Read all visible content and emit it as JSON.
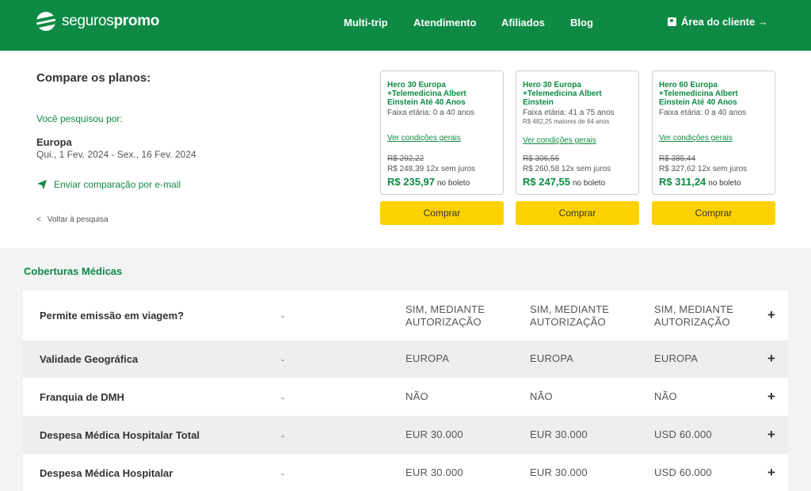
{
  "header": {
    "logo_thin": "seguros",
    "logo_bold": "promo",
    "nav": [
      "Multi-trip",
      "Atendimento",
      "Afiliados",
      "Blog"
    ],
    "client_area": "Área do cliente →"
  },
  "search": {
    "title": "Compare os planos:",
    "searched_label": "Você pesquisou por:",
    "destination": "Europa",
    "dates": "Qui., 1 Fev. 2024 - Sex., 16 Fev. 2024",
    "send_email": "Enviar comparação por e-mail",
    "back": "Voltar à pesquisa",
    "back_chevron": "<"
  },
  "plans": [
    {
      "name": "Hero 30 Europa +Telemedicina Albert Einstein Até 40 Anos",
      "age": "Faixa etária: 0 a 40 anos",
      "age_note": "",
      "conditions": "Ver condições gerais",
      "old_price": "R$ 292,22",
      "installments": "R$ 248,39 12x sem juros",
      "price": "R$ 235,97",
      "price_suffix": "no boleto",
      "buy": "Comprar"
    },
    {
      "name": "Hero 30 Europa +Telemedicina Albert Einstein",
      "age": "Faixa etária: 41 a 75 anos",
      "age_note": "R$ 482,25 maiores de 64 anos",
      "conditions": "Ver condições gerais",
      "old_price": "R$ 306,56",
      "installments": "R$ 260,58 12x sem juros",
      "price": "R$ 247,55",
      "price_suffix": "no boleto",
      "buy": "Comprar"
    },
    {
      "name": "Hero 60 Europa +Telemedicina Albert Einstein Até 40 Anos",
      "age": "Faixa etária: 0 a 40 anos",
      "age_note": "",
      "conditions": "Ver condições gerais",
      "old_price": "R$ 385,44",
      "installments": "R$ 327,62 12x sem juros",
      "price": "R$ 311,24",
      "price_suffix": "no boleto",
      "buy": "Comprar"
    }
  ],
  "coverage": {
    "title": "Coberturas Médicas",
    "rows": [
      {
        "label": "Permite emissão em viagem?",
        "dash": "-",
        "values": [
          "SIM, MEDIANTE AUTORIZAÇÃO",
          "SIM, MEDIANTE AUTORIZAÇÃO",
          "SIM, MEDIANTE AUTORIZAÇÃO"
        ],
        "plus": "+"
      },
      {
        "label": "Validade Geográfica",
        "dash": "-",
        "values": [
          "EUROPA",
          "EUROPA",
          "EUROPA"
        ],
        "plus": "+"
      },
      {
        "label": "Franquia de DMH",
        "dash": "-",
        "values": [
          "NÃO",
          "NÃO",
          "NÃO"
        ],
        "plus": "+"
      },
      {
        "label": "Despesa Médica Hospitalar Total",
        "dash": "-",
        "values": [
          "EUR 30.000",
          "EUR 30.000",
          "USD 60.000"
        ],
        "plus": "+"
      },
      {
        "label": "Despesa Médica Hospitalar",
        "dash": "-",
        "values": [
          "EUR 30.000",
          "EUR 30.000",
          "USD 60.000"
        ],
        "plus": "+"
      }
    ]
  },
  "colors": {
    "brand_green": "#0e8a44",
    "buy_yellow": "#fdd100"
  }
}
